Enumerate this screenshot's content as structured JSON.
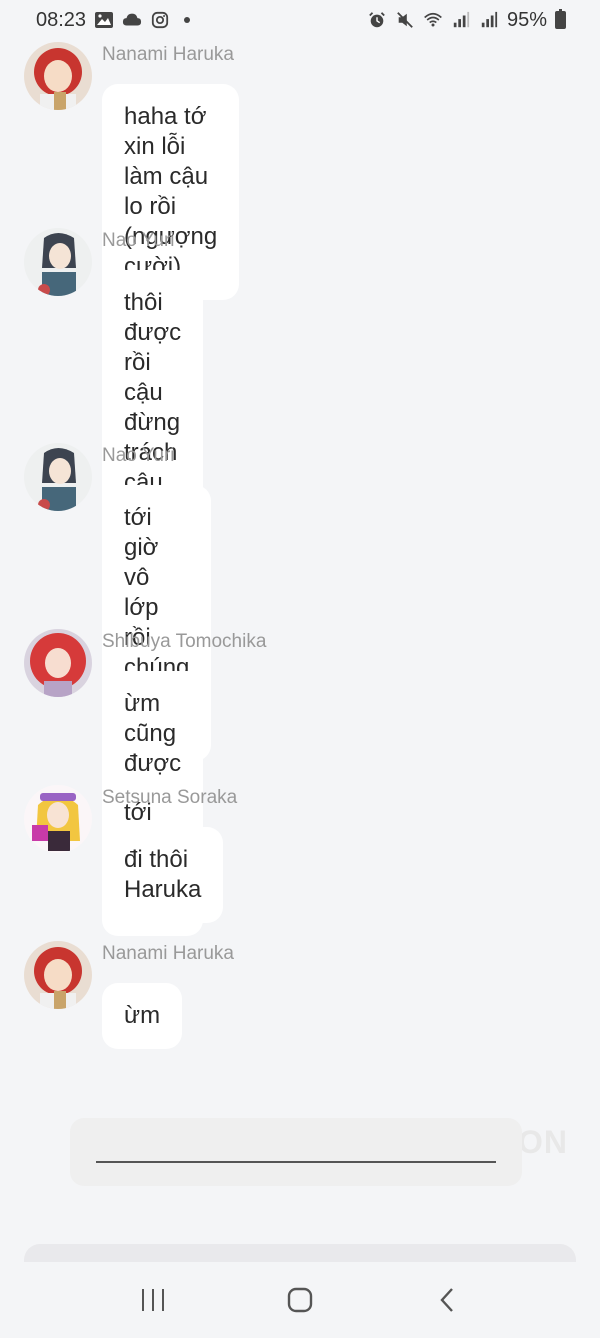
{
  "status_bar": {
    "time": "08:23",
    "battery": "95%"
  },
  "messages": [
    {
      "author": "Nanami Haruka",
      "text": "haha tớ xin lỗi làm cậu lo rồi\n(ngượng cười)",
      "avatar_color": "#c8352f"
    },
    {
      "author": "Nao Yuri",
      "text": "thôi được rồi cậu đừng trách\ncậu ấy nữa chắc cậu ấy có lí do\nriêng nên mới tới trễ ấy thôi",
      "avatar_color": "#3d4450"
    },
    {
      "author": "Nao Yuri",
      "text": "tới giờ vô lớp rồi chúng ta đi\nthôi",
      "avatar_color": "#3d4450"
    },
    {
      "author": "Shibuya Tomochika",
      "text": "ừm cũng được",
      "avatar_color": "#d63a3a"
    },
    {
      "author": "Setsuna Soraka",
      "text": "đi thôi Haruka",
      "avatar_color": "#f2c640"
    },
    {
      "author": "Nanami Haruka",
      "text": "ừm",
      "avatar_color": "#c8352f"
    }
  ],
  "watermark": "ON",
  "icons": {
    "status_left": [
      "image-icon",
      "cloud-icon",
      "instagram-icon",
      "dot-icon"
    ],
    "status_right": [
      "alarm-icon",
      "mute-icon",
      "wifi-icon",
      "signal-icon",
      "signal-icon",
      "battery-icon"
    ],
    "nav": [
      "recents-icon",
      "home-icon",
      "back-icon"
    ]
  }
}
